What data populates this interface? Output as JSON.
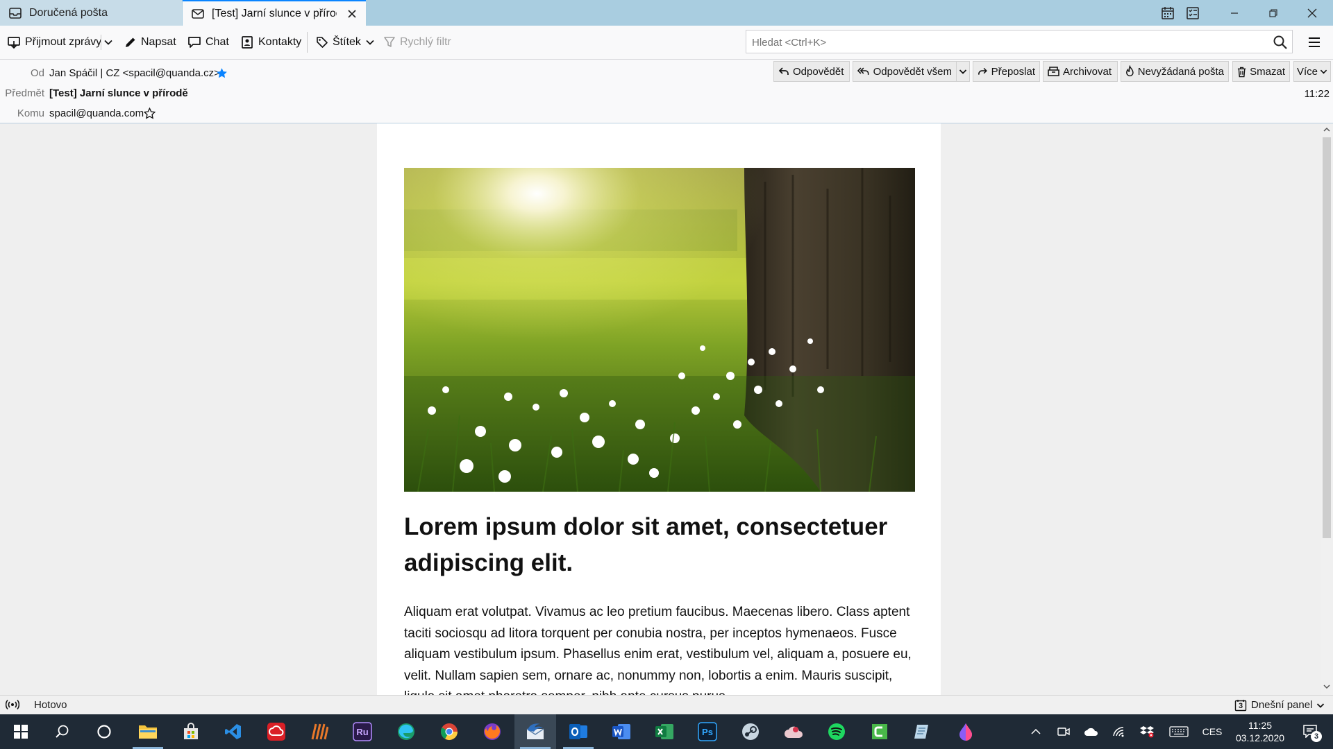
{
  "tabs": [
    {
      "label": "Doručená pošta",
      "icon": "inbox-icon"
    },
    {
      "label": "[Test] Jarní slunce v přírodě",
      "icon": "envelope-icon"
    }
  ],
  "toolbar": {
    "get_messages": "Přijmout zprávy",
    "write": "Napsat",
    "chat": "Chat",
    "contacts": "Kontakty",
    "tag": "Štítek",
    "quick_filter": "Rychlý filtr",
    "search_placeholder": "Hledat <Ctrl+K>"
  },
  "header": {
    "from_label": "Od",
    "from_value": "Jan Spáčil | CZ <spacil@quanda.cz>",
    "subject_label": "Předmět",
    "subject_value": "[Test] Jarní slunce v přírodě",
    "to_label": "Komu",
    "to_value": "spacil@quanda.com",
    "time": "11:22",
    "actions": {
      "reply": "Odpovědět",
      "reply_all": "Odpovědět všem",
      "forward": "Přeposlat",
      "archive": "Archivovat",
      "junk": "Nevyžádaná pošta",
      "delete": "Smazat",
      "more": "Více"
    }
  },
  "email": {
    "headline": "Lorem ipsum dolor sit amet, consectetuer adipiscing elit.",
    "body": "Aliquam erat volutpat. Vivamus ac leo pretium faucibus. Maecenas libero. Class aptent taciti sociosqu ad litora torquent per conubia nostra, per inceptos hymenaeos. Fusce aliquam vestibulum ipsum. Phasellus enim erat, vestibulum vel, aliquam a, posuere eu, velit. Nullam sapien sem, ornare ac, nonummy non, lobortis a enim. Mauris suscipit, ligula sit amet pharetra semper, nibh ante cursus purus."
  },
  "status": {
    "text": "Hotovo",
    "today_pane": "Dnešní panel",
    "today_badge": "3"
  },
  "taskbar": {
    "lang": "CES",
    "time": "11:25",
    "date": "03.12.2020",
    "notif_count": "3"
  },
  "colors": {
    "tabbar_bg": "#a9cde0",
    "active_tab_accent": "#0a84ff",
    "taskbar_bg": "#1f2a36"
  }
}
